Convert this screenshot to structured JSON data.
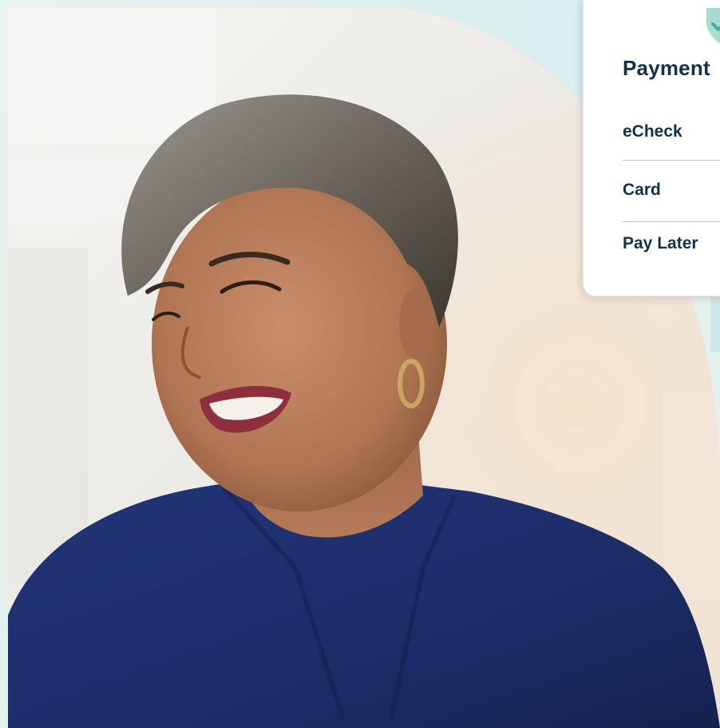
{
  "payment_panel": {
    "title": "Payment",
    "options": [
      {
        "label": "eCheck"
      },
      {
        "label": "Card"
      },
      {
        "label": "Pay Later"
      }
    ]
  },
  "colors": {
    "text_dark": "#123347",
    "shield": "#a8dcd0",
    "background_mint": "#e4f1ed",
    "shirt_navy": "#1f3170"
  },
  "icons": {
    "shield": "shield-check-icon"
  }
}
